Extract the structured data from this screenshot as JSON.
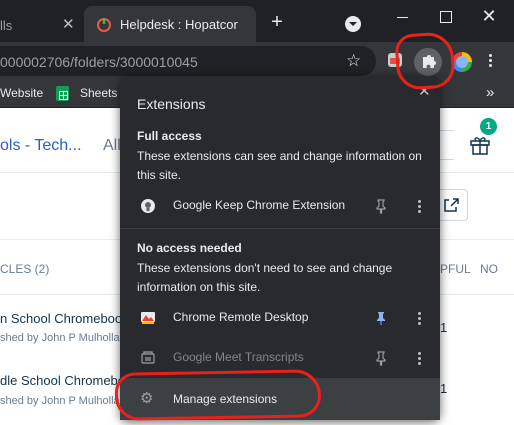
{
  "browser": {
    "tabs": [
      {
        "title": "lls",
        "active": false
      },
      {
        "title": "Helpdesk : Hopatcong",
        "active": true
      }
    ],
    "url": "000002706/folders/3000010045",
    "bookmarks": [
      "Website",
      "Sheets"
    ]
  },
  "page": {
    "breadcrumb": [
      "ols - Tech...",
      "All"
    ],
    "notification_count": "1",
    "articles_header": "CLES (2)",
    "columns": [
      "PFUL",
      "NO"
    ],
    "articles": [
      {
        "title": "n School Chromebook",
        "meta": "shed by John P Mulholla",
        "count": "1"
      },
      {
        "title": "dle School Chromebo",
        "meta": "shed by John P Mulholla",
        "count": "1"
      }
    ]
  },
  "extensions_popup": {
    "title": "Extensions",
    "full_access": {
      "title": "Full access",
      "description": "These extensions can see and change information on this site.",
      "items": [
        {
          "name": "Google Keep Chrome Extension",
          "pinned": false,
          "icon": "keep-icon"
        }
      ]
    },
    "no_access": {
      "title": "No access needed",
      "description": "These extensions don't need to see and change information on this site.",
      "items": [
        {
          "name": "Chrome Remote Desktop",
          "pinned": true,
          "icon": "remote-desktop-icon"
        },
        {
          "name": "Google Meet Transcripts",
          "pinned": false,
          "icon": "meet-transcripts-icon"
        }
      ]
    },
    "manage_label": "Manage extensions"
  },
  "colors": {
    "annotation": "#e8211b",
    "pinned": "#8ab4f8",
    "link": "#2c5cc5"
  }
}
